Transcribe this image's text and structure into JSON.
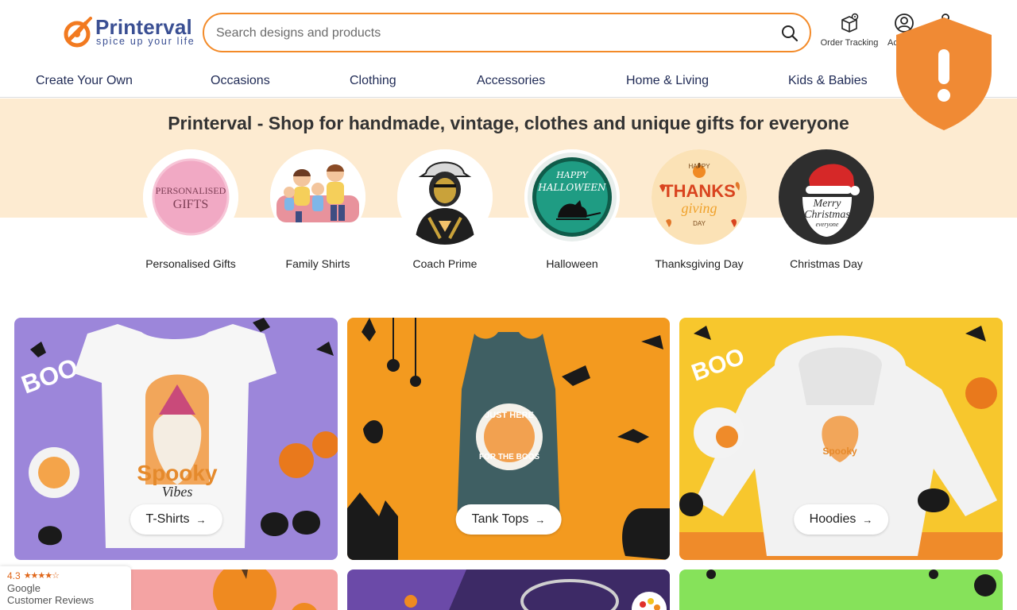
{
  "brand": {
    "name": "Printerval",
    "tagline": "spice up your life",
    "color": "#3a4f93",
    "accent": "#f38a28"
  },
  "search": {
    "placeholder": "Search designs and products",
    "icon": "search-icon"
  },
  "header_actions": {
    "order_tracking": "Order Tracking",
    "account": "Account"
  },
  "nav": {
    "items": [
      "Create Your Own",
      "Occasions",
      "Clothing",
      "Accessories",
      "Home & Living",
      "Kids & Babies"
    ]
  },
  "hero": {
    "title": "Printerval - Shop for handmade, vintage, clothes and unique gifts for everyone",
    "background": "#fdebd1"
  },
  "categories": [
    {
      "label": "Personalised Gifts",
      "art_text": "PERSONALISED GIFTS"
    },
    {
      "label": "Family Shirts"
    },
    {
      "label": "Coach Prime"
    },
    {
      "label": "Halloween",
      "art_text": "HAPPY HALLOWEEN"
    },
    {
      "label": "Thanksgiving Day",
      "art_text": "HAPPY THANKS giving DAY"
    },
    {
      "label": "Christmas Day",
      "art_text": "Merry Christmas everyone"
    }
  ],
  "tiles": [
    {
      "label": "T-Shirts",
      "art_text": "Spooky Vibes",
      "background": "#9c86da"
    },
    {
      "label": "Tank Tops",
      "art_text": "JUST HERE FOR THE BOOS",
      "background": "#f39a1f"
    },
    {
      "label": "Hoodies",
      "art_text": "Spooky Vibes",
      "background": "#f7c72d"
    }
  ],
  "google_reviews": {
    "rating": "4.3",
    "stars": "★★★★☆",
    "brand": "Google",
    "subtitle": "Customer Reviews"
  }
}
